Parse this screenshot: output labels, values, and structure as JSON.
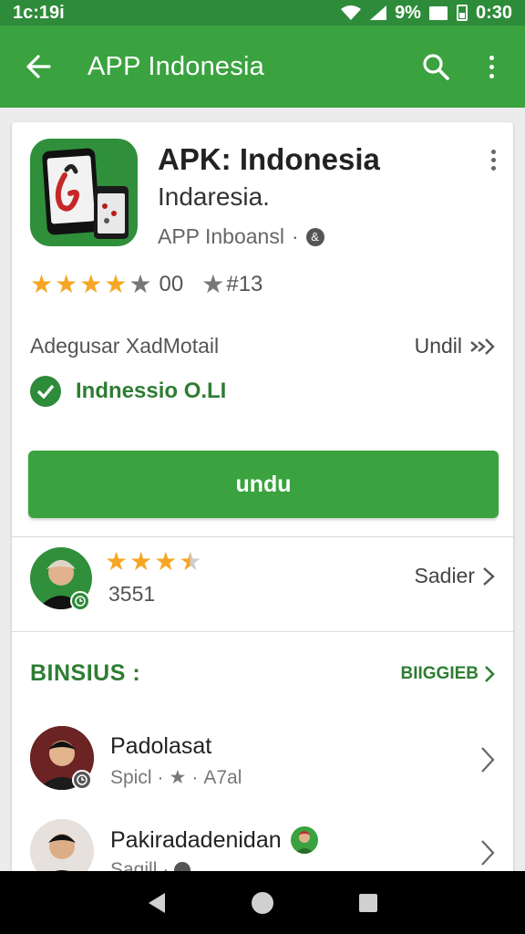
{
  "status_bar": {
    "time": "1c:19i",
    "battery": "9%",
    "clock_right": "0:30"
  },
  "app_bar": {
    "title": "APP Indonesia"
  },
  "app": {
    "name": "APK: Indonesia",
    "subtitle": "Indaresia.",
    "developer": "APP Inboansl",
    "developer_badge": "&",
    "rating_stars": 4,
    "rating_count": "00",
    "rating_star_label": "#13"
  },
  "info": {
    "left": "Adegusar XadMotail",
    "right": "Undil",
    "verified": "Indnessio O.LI"
  },
  "install_button": "undu",
  "review": {
    "stars": 3.5,
    "count": "3551",
    "link": "Sadier"
  },
  "section": {
    "title": "BINSIUS :",
    "more": "BIIGGIEB"
  },
  "list": [
    {
      "name": "Padolasat",
      "meta_left": "Spicl",
      "meta_right": "A7al"
    },
    {
      "name": "Pakiradadenidan",
      "meta_left": "Sagill"
    }
  ],
  "colors": {
    "primary": "#3aa23f",
    "status_bar": "#2e8b3a",
    "accent_text": "#2e7d32",
    "star": "#f5a623"
  },
  "icons": [
    "wifi-icon",
    "signal-icon",
    "battery-icon",
    "back-arrow-icon",
    "search-icon",
    "more-vert-icon",
    "check-icon",
    "chevron-right-icon",
    "nav-back-icon",
    "nav-home-icon",
    "nav-recents-icon"
  ]
}
